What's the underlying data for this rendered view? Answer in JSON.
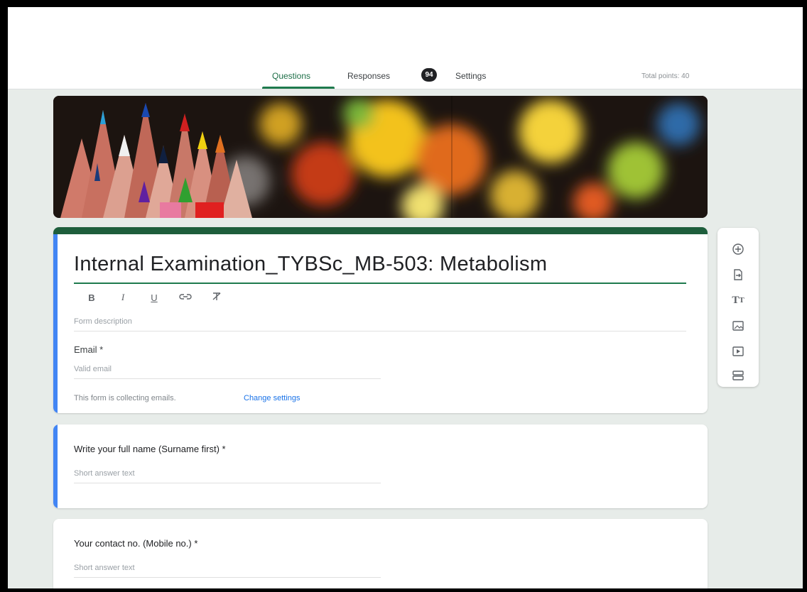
{
  "tabs": {
    "questions": "Questions",
    "responses": "Responses",
    "responses_count": "94",
    "settings": "Settings"
  },
  "total_points": "Total points: 40",
  "form": {
    "title": "Internal Examination_TYBSc_MB-503: Metabolism",
    "format_buttons": {
      "bold": "B",
      "italic": "I",
      "underline": "U"
    },
    "description_placeholder": "Form description",
    "email_label": "Email *",
    "email_placeholder": "Valid email",
    "collecting_text": "This form is collecting emails.",
    "change_settings": "Change settings"
  },
  "questions": [
    {
      "title": "Write your full name (Surname first) *",
      "answer": "Short answer text"
    },
    {
      "title": "Your contact no. (Mobile no.) *",
      "answer": "Short answer text"
    }
  ],
  "toolbar_icons": [
    "add-question-icon",
    "import-questions-icon",
    "add-title-icon",
    "add-image-icon",
    "add-video-icon",
    "add-section-icon"
  ],
  "colors": {
    "accent": "#1e7a4d",
    "question_highlight": "#4285f4",
    "link": "#1a73e8",
    "background": "#e7ece9"
  }
}
